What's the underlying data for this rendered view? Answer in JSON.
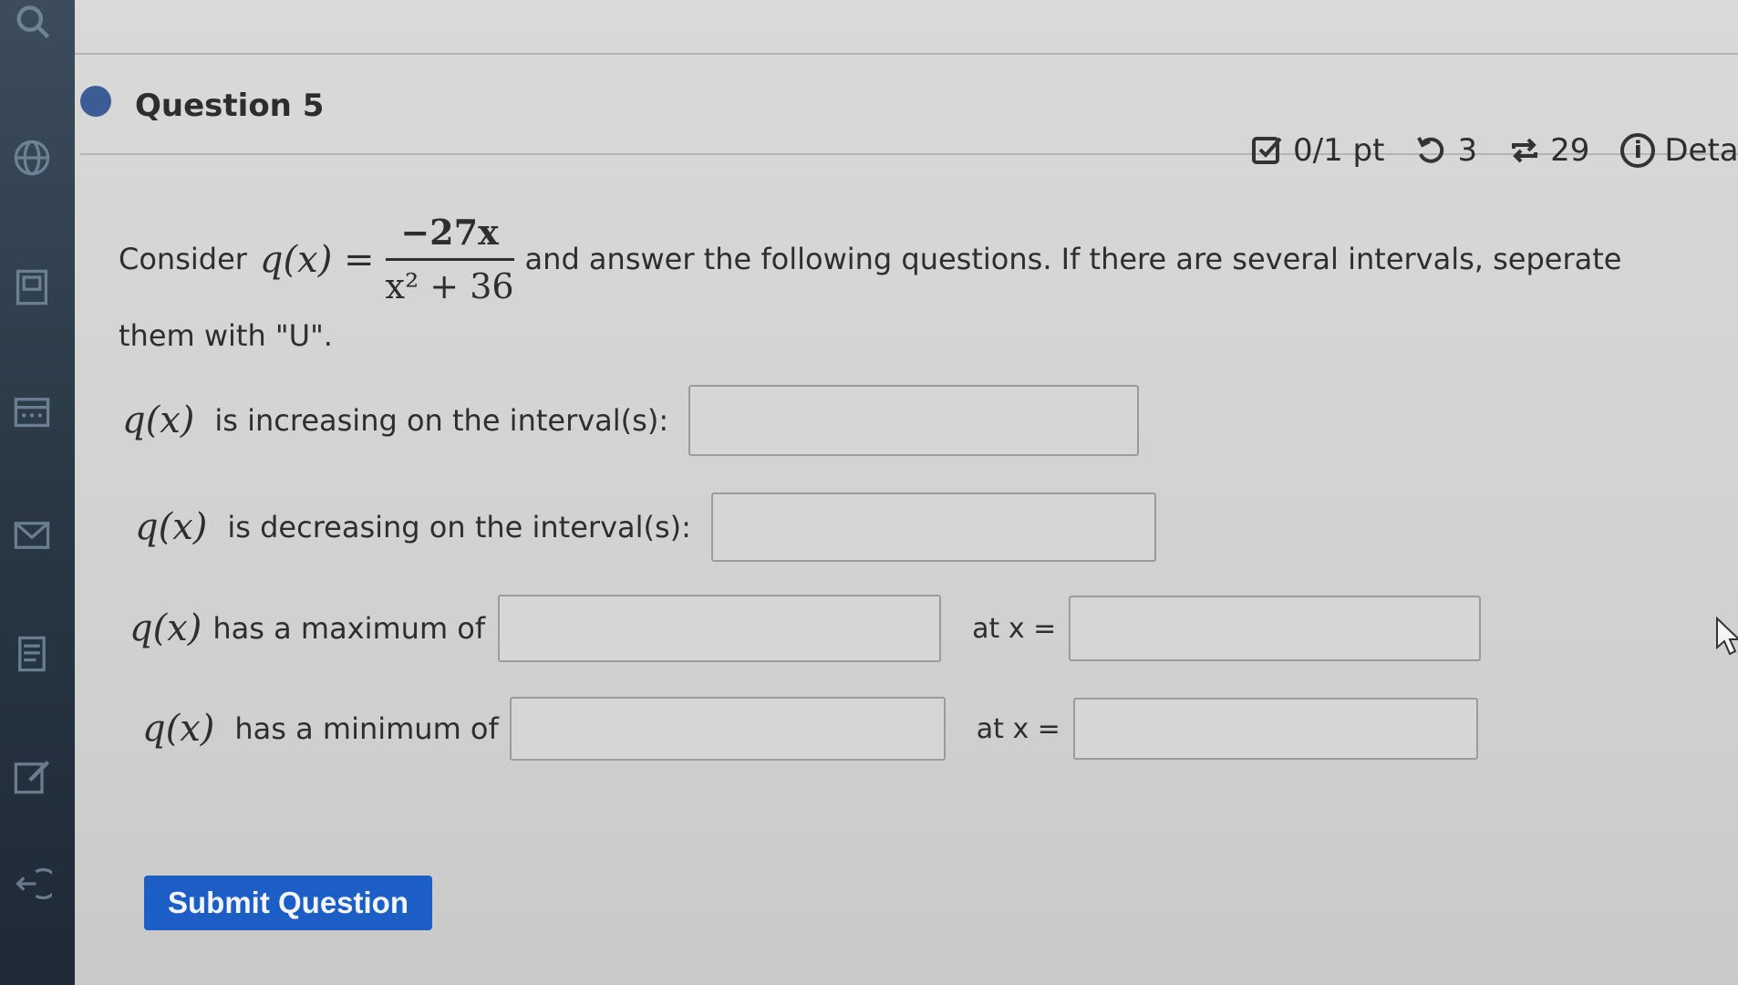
{
  "question": {
    "title": "Question 5",
    "points": "0/1 pt",
    "attempts": "3",
    "retries": "29",
    "details_label": "Details"
  },
  "prompt": {
    "consider": "Consider",
    "function_lhs": "q(x) =",
    "numerator": "−27x",
    "denominator": "x² + 36",
    "text_after": "and answer the following questions. If there are several intervals, seperate",
    "text_line2": "them with \"U\"."
  },
  "rows": {
    "increasing": {
      "func": "q(x)",
      "label": "is increasing on the interval(s):",
      "value": ""
    },
    "decreasing": {
      "func": "q(x)",
      "label": "is decreasing on the interval(s):",
      "value": ""
    },
    "maximum": {
      "func": "q(x)",
      "label": "has a maximum of",
      "value": "",
      "at_label": "at x =",
      "at_value": ""
    },
    "minimum": {
      "func": "q(x)",
      "label": "has a minimum of",
      "value": "",
      "at_label": "at x =",
      "at_value": ""
    }
  },
  "submit_label": "Submit Question",
  "colors": {
    "accent": "#1d5ec6",
    "question_dot": "#3b5c95",
    "sidebar": "#2a3845"
  },
  "icons": {
    "sidebar": [
      "search-icon",
      "globe-icon",
      "book-icon",
      "calendar-icon",
      "mail-icon",
      "notes-icon",
      "edit-icon",
      "logout-icon"
    ],
    "meta": [
      "checkbox-icon",
      "undo-icon",
      "repeat-icon",
      "info-icon"
    ]
  }
}
